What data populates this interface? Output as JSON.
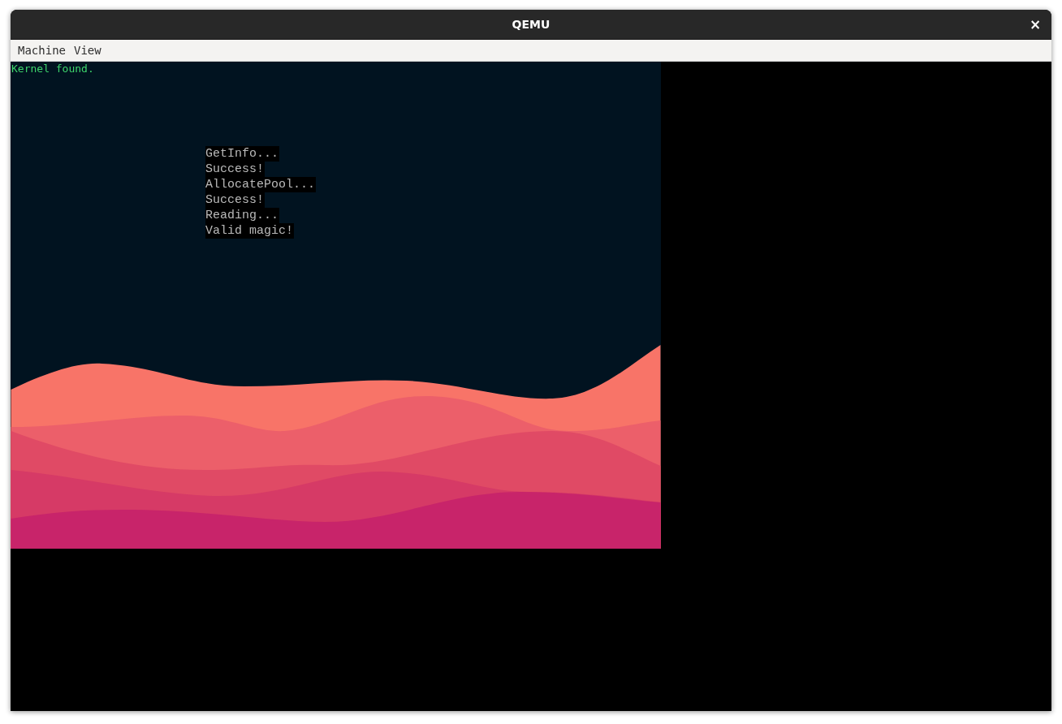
{
  "window": {
    "title": "QEMU",
    "close": "×"
  },
  "menu": [
    {
      "label": "Machine"
    },
    {
      "label": "View"
    }
  ],
  "console": {
    "status": "Kernel found.",
    "log": [
      "GetInfo...",
      "Success!",
      "AllocatePool...",
      "Success!",
      "Reading...",
      "Valid magic!"
    ]
  }
}
